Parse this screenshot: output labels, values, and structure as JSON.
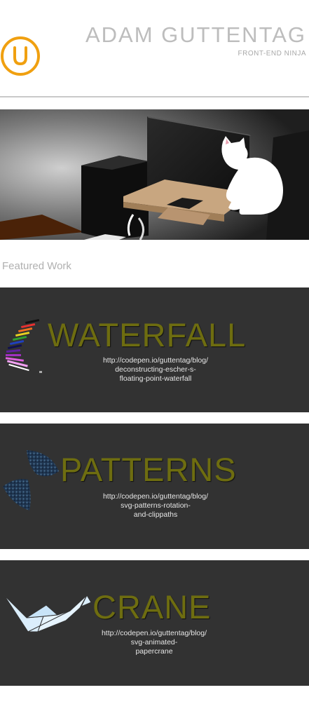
{
  "header": {
    "title": "ADAM GUTTENTAG",
    "subtitle": "FRONT-END NINJA",
    "logo_icon": "u-logo-icon",
    "logo_color": "#f0a010"
  },
  "featured": {
    "label": "Featured Work"
  },
  "cards": [
    {
      "title": "WATERFALL",
      "link_lines": [
        "http://codepen.io/guttentag/blog/",
        "deconstructing-escher-s-",
        "floating-point-waterfall"
      ],
      "icon": "waterfall-icon"
    },
    {
      "title": "PATTERNS",
      "link_lines": [
        "http://codepen.io/guttentag/blog/",
        "svg-patterns-rotation-",
        "and-clippaths"
      ],
      "icon": "patterns-icon"
    },
    {
      "title": "CRANE",
      "link_lines": [
        "http://codepen.io/guttentag/blog/",
        "svg-animated-",
        "papercrane"
      ],
      "icon": "crane-icon"
    }
  ],
  "colors": {
    "card_bg": "#323232",
    "title_olive": "#6e6d10",
    "header_gray": "#bdbdbd"
  }
}
